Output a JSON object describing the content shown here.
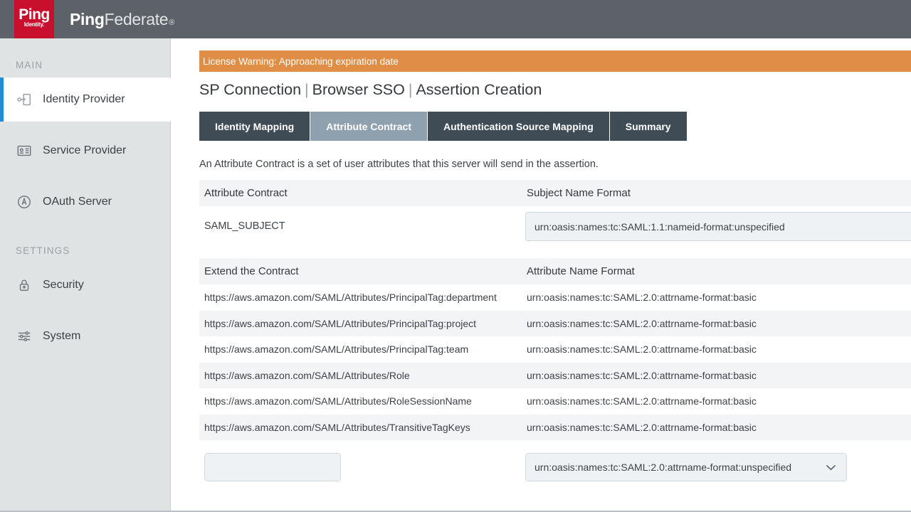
{
  "header": {
    "logo_ping": "Ping",
    "logo_identity": "Identity.",
    "brand_ping": "Ping",
    "brand_federate": "Federate",
    "brand_registered": "®"
  },
  "sidebar": {
    "sections": [
      {
        "label": "MAIN",
        "items": [
          {
            "label": "Identity Provider",
            "icon": "identity-provider-icon",
            "active": true
          },
          {
            "label": "Service Provider",
            "icon": "service-provider-icon",
            "active": false
          },
          {
            "label": "OAuth Server",
            "icon": "oauth-server-icon",
            "active": false
          }
        ]
      },
      {
        "label": "SETTINGS",
        "items": [
          {
            "label": "Security",
            "icon": "lock-icon",
            "active": false
          },
          {
            "label": "System",
            "icon": "sliders-icon",
            "active": false
          }
        ]
      }
    ]
  },
  "banner": {
    "text": "License Warning: Approaching expiration date",
    "color": "#e08e45"
  },
  "page": {
    "title_part1": "SP Connection",
    "title_part2": "Browser SSO",
    "title_part3": "Assertion Creation",
    "separator": "|"
  },
  "tabs": [
    {
      "label": "Identity Mapping",
      "active": false
    },
    {
      "label": "Attribute Contract",
      "active": true
    },
    {
      "label": "Authentication Source Mapping",
      "active": false
    },
    {
      "label": "Summary",
      "active": false
    }
  ],
  "intro_text": "An Attribute Contract is a set of user attributes that this server will send in the assertion.",
  "contract_table": {
    "headers": [
      "Attribute Contract",
      "Subject Name Format"
    ],
    "subject_name": "SAML_SUBJECT",
    "subject_format_value": "urn:oasis:names:tc:SAML:1.1:nameid-format:unspecified"
  },
  "extend_table": {
    "headers": [
      "Extend the Contract",
      "Attribute Name Format"
    ],
    "rows": [
      {
        "attribute": "https://aws.amazon.com/SAML/Attributes/PrincipalTag:department",
        "format": "urn:oasis:names:tc:SAML:2.0:attrname-format:basic"
      },
      {
        "attribute": "https://aws.amazon.com/SAML/Attributes/PrincipalTag:project",
        "format": "urn:oasis:names:tc:SAML:2.0:attrname-format:basic"
      },
      {
        "attribute": "https://aws.amazon.com/SAML/Attributes/PrincipalTag:team",
        "format": "urn:oasis:names:tc:SAML:2.0:attrname-format:basic"
      },
      {
        "attribute": "https://aws.amazon.com/SAML/Attributes/Role",
        "format": "urn:oasis:names:tc:SAML:2.0:attrname-format:basic"
      },
      {
        "attribute": "https://aws.amazon.com/SAML/Attributes/RoleSessionName",
        "format": "urn:oasis:names:tc:SAML:2.0:attrname-format:basic"
      },
      {
        "attribute": "https://aws.amazon.com/SAML/Attributes/TransitiveTagKeys",
        "format": "urn:oasis:names:tc:SAML:2.0:attrname-format:basic"
      }
    ],
    "new_attribute_value": "",
    "new_attribute_placeholder": "",
    "new_format_value": "urn:oasis:names:tc:SAML:2.0:attrname-format:unspecified",
    "chevron": "⌄"
  },
  "colors": {
    "header_bg": "#5c6268",
    "logo_red": "#c8102e",
    "sidebar_bg": "#dfe3e4",
    "accent_blue": "#1f8dd6",
    "tab_dark": "#3f4c55",
    "tab_active": "#8fa0ae",
    "warning_orange": "#e08e45"
  }
}
